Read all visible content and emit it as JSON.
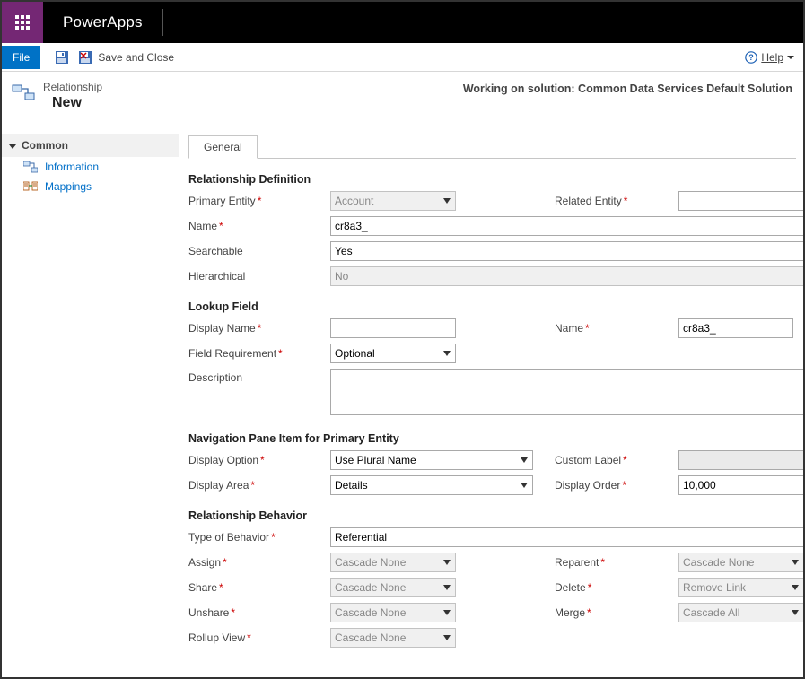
{
  "brand": "PowerApps",
  "toolbar": {
    "file": "File",
    "save_close": "Save and Close",
    "help_text": "Help"
  },
  "header": {
    "subtitle": "Relationship",
    "title": "New",
    "solution_label": "Working on solution: Common Data Services Default Solution"
  },
  "sidebar": {
    "section": "Common",
    "items": [
      {
        "label": "Information"
      },
      {
        "label": "Mappings"
      }
    ]
  },
  "tabs": {
    "general": "General"
  },
  "section_titles": {
    "rel_def": "Relationship Definition",
    "lookup": "Lookup Field",
    "nav_pane": "Navigation Pane Item for Primary Entity",
    "behavior": "Relationship Behavior"
  },
  "labels": {
    "primary_entity": "Primary Entity",
    "related_entity": "Related Entity",
    "name": "Name",
    "searchable": "Searchable",
    "hierarchical": "Hierarchical",
    "display_name": "Display Name",
    "field_requirement": "Field Requirement",
    "description": "Description",
    "display_option": "Display Option",
    "custom_label": "Custom Label",
    "display_area": "Display Area",
    "display_order": "Display Order",
    "type_behavior": "Type of Behavior",
    "assign": "Assign",
    "reparent": "Reparent",
    "share": "Share",
    "delete": "Delete",
    "unshare": "Unshare",
    "merge": "Merge",
    "rollup_view": "Rollup View"
  },
  "values": {
    "primary_entity": "Account",
    "related_entity": "",
    "name": "cr8a3_",
    "searchable": "Yes",
    "hierarchical": "No",
    "lookup_display_name": "",
    "lookup_name": "cr8a3_",
    "field_requirement": "Optional",
    "description": "",
    "display_option": "Use Plural Name",
    "custom_label": "",
    "display_area": "Details",
    "display_order": "10,000",
    "type_behavior": "Referential",
    "assign": "Cascade None",
    "reparent": "Cascade None",
    "share": "Cascade None",
    "delete": "Remove Link",
    "unshare": "Cascade None",
    "merge": "Cascade All",
    "rollup_view": "Cascade None"
  }
}
